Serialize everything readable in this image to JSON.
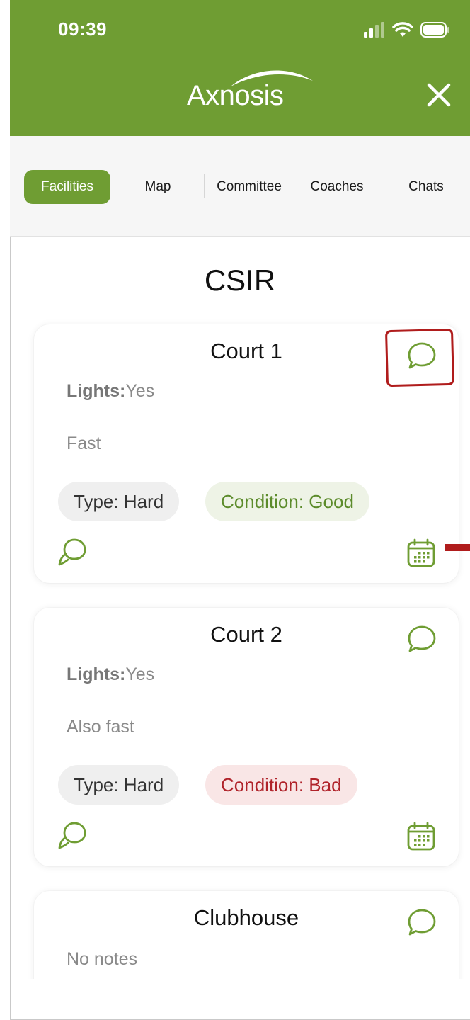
{
  "status": {
    "time": "09:39"
  },
  "header": {
    "logo": "Axnosis"
  },
  "tabs": [
    {
      "label": "Facilities",
      "active": true
    },
    {
      "label": "Map",
      "active": false
    },
    {
      "label": "Committee",
      "active": false
    },
    {
      "label": "Coaches",
      "active": false
    },
    {
      "label": "Chats",
      "active": false
    }
  ],
  "page": {
    "title": "CSIR"
  },
  "facilities": [
    {
      "name": "Court 1",
      "lights_label": "Lights:",
      "lights_value": "Yes",
      "notes": "Fast",
      "type": "Type: Hard",
      "condition": "Condition: Good",
      "condition_status": "good"
    },
    {
      "name": "Court 2",
      "lights_label": "Lights:",
      "lights_value": "Yes",
      "notes": "Also fast",
      "type": "Type: Hard",
      "condition": "Condition: Bad",
      "condition_status": "bad"
    },
    {
      "name": "Clubhouse",
      "notes": "No notes"
    }
  ],
  "icons": {
    "close": "close-icon",
    "message": "chat-bubble-icon",
    "chats": "chats-icon",
    "calendar": "calendar-icon"
  },
  "colors": {
    "brand": "#6f9d33",
    "good_text": "#5c8b2b",
    "good_bg": "#eef3e6",
    "bad_text": "#b0232a",
    "bad_bg": "#f9e6e6",
    "annotation": "#b01c1c"
  }
}
